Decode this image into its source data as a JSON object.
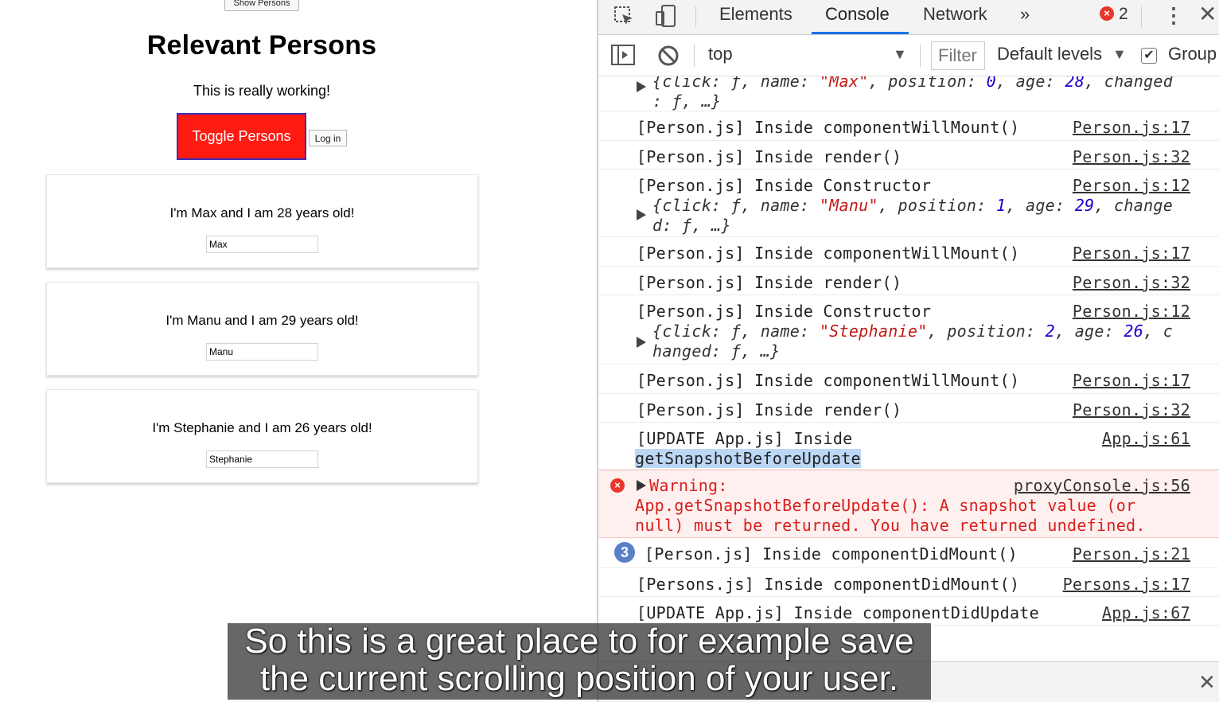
{
  "app": {
    "show_button": "Show Persons",
    "title": "Relevant Persons",
    "subtitle": "This is really working!",
    "toggle_button": "Toggle Persons",
    "login_button": "Log in",
    "persons": [
      {
        "text": "I'm Max and I am 28 years old!",
        "value": "Max"
      },
      {
        "text": "I'm Manu and I am 29 years old!",
        "value": "Manu"
      },
      {
        "text": "I'm Stephanie and I am 26 years old!",
        "value": "Stephanie"
      }
    ]
  },
  "devtools": {
    "tabs": [
      "Elements",
      "Console",
      "Network",
      "»"
    ],
    "active_tab": "Console",
    "error_count": "2",
    "toolbar": {
      "context": "top",
      "filter_placeholder": "Filter",
      "levels": "Default levels",
      "group_label": "Group"
    },
    "colors": {
      "string": "#c41a16",
      "number": "#1c00cf",
      "error": "#d8201c",
      "tab_accent": "#1a73e8"
    },
    "console": {
      "obj_max_1": "{click: ƒ, name: \"Max\", position: 0, age: 28, changed",
      "obj_max_2": ": ƒ, …}",
      "r1_msg": "[Person.js] Inside componentWillMount()",
      "r1_src": "Person.js:17",
      "r2_msg": "[Person.js] Inside render()",
      "r2_src": "Person.js:32",
      "r3_msg": "[Person.js] Inside Constructor",
      "r3_src": "Person.js:12",
      "obj_manu_1": "{click: ƒ, name: \"Manu\", position: 1, age: 29, change",
      "obj_manu_2": "d: ƒ, …}",
      "r4_msg": "[Person.js] Inside componentWillMount()",
      "r4_src": "Person.js:17",
      "r5_msg": "[Person.js] Inside render()",
      "r5_src": "Person.js:32",
      "r6_msg": "[Person.js] Inside Constructor",
      "r6_src": "Person.js:12",
      "obj_steph_1": "{click: ƒ, name: \"Stephanie\", position: 2, age: 26, c",
      "obj_steph_2": "hanged: ƒ, …}",
      "r7_msg": "[Person.js] Inside componentWillMount()",
      "r7_src": "Person.js:17",
      "r8_msg": "[Person.js] Inside render()",
      "r8_src": "Person.js:32",
      "r9_msg": "[UPDATE App.js] Inside",
      "r9_msg2": "getSnapshotBeforeUpdate",
      "r9_src": "App.js:61",
      "warn_1": "Warning:",
      "warn_src": "proxyConsole.js:56",
      "warn_2": "App.getSnapshotBeforeUpdate(): A snapshot value (or",
      "warn_3": "null) must be returned. You have returned undefined.",
      "r10_count": "3",
      "r10_msg": "[Person.js] Inside componentDidMount()",
      "r10_src": "Person.js:21",
      "r11_msg": "[Persons.js] Inside componentDidMount()",
      "r11_src": "Persons.js:17",
      "r12_msg": "[UPDATE App.js] Inside componentDidUpdate",
      "r12_src": "App.js:67"
    }
  },
  "caption": {
    "line1": "So this is a great place to for example save",
    "line2": "the current scrolling position of your user."
  }
}
